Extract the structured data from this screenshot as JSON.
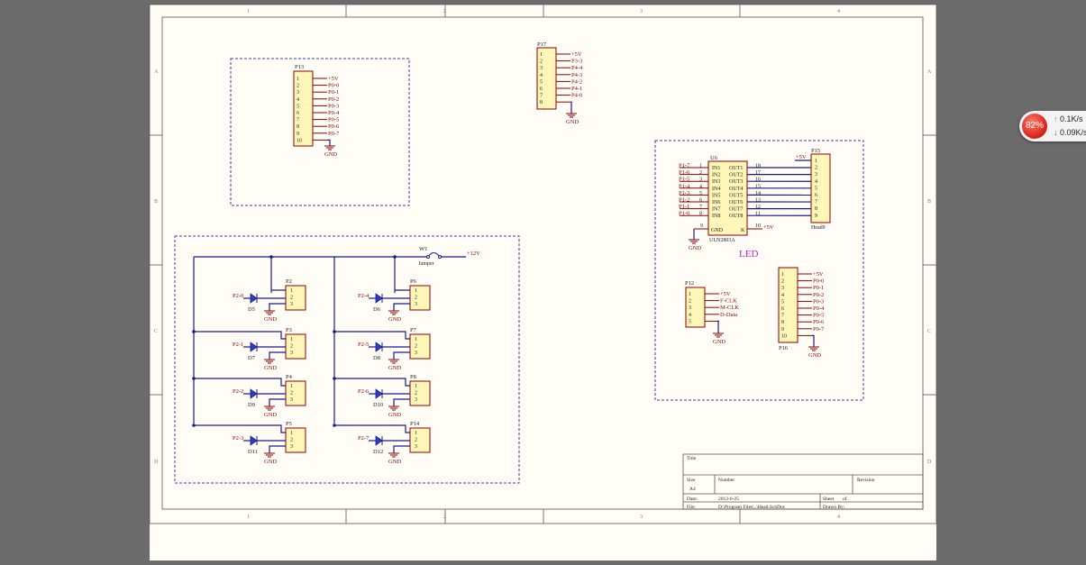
{
  "zones": {
    "columns": [
      "1",
      "2",
      "3",
      "4"
    ],
    "rows": [
      "A",
      "B",
      "C",
      "D"
    ]
  },
  "power": {
    "v5": "+5V",
    "v12": "+12V",
    "gnd": "GND"
  },
  "p13": {
    "ref": "P13",
    "pins": [
      "1",
      "2",
      "3",
      "4",
      "5",
      "6",
      "7",
      "8",
      "9",
      "10"
    ],
    "nets": [
      "+5V",
      "P0-0",
      "P0-1",
      "P0-2",
      "P0-3",
      "P0-4",
      "P0-5",
      "P0-6",
      "P0-7"
    ]
  },
  "p17": {
    "ref": "P17",
    "pins": [
      "1",
      "2",
      "3",
      "4",
      "5",
      "6",
      "7",
      "8"
    ],
    "nets": [
      "+5V",
      "P3-3",
      "P4-4",
      "P4-3",
      "P4-2",
      "P4-1",
      "P4-0"
    ]
  },
  "u6": {
    "ref": "U6",
    "part": "ULN2803A",
    "left_pins": [
      "1",
      "2",
      "3",
      "4",
      "5",
      "6",
      "7",
      "8"
    ],
    "in_labels": [
      "IN1",
      "IN2",
      "IN3",
      "IN4",
      "IN5",
      "IN6",
      "IN7",
      "IN8"
    ],
    "out_labels": [
      "OUT1",
      "OUT2",
      "OUT3",
      "OUT4",
      "OUT5",
      "OUT6",
      "OUT7",
      "OUT8"
    ],
    "right_pins": [
      "18",
      "17",
      "16",
      "15",
      "14",
      "13",
      "12",
      "11"
    ],
    "in_nets": [
      "P1-7",
      "P1-6",
      "P1-5",
      "P1-4",
      "P1-3",
      "P1-2",
      "P1-1",
      "P1-0"
    ],
    "gnd_label": "GND",
    "gnd_pin": "9",
    "k_label": "K",
    "k_pin": "10"
  },
  "p15": {
    "ref": "P15",
    "part": "Head9",
    "pins": [
      "1",
      "2",
      "3",
      "4",
      "5",
      "6",
      "7",
      "8",
      "9"
    ]
  },
  "led_label": "LED",
  "p12": {
    "ref": "P12",
    "pins": [
      "1",
      "2",
      "3",
      "4",
      "5"
    ],
    "nets": [
      "+5V",
      "F-CLK",
      "M-CLK",
      "D-Data"
    ]
  },
  "p16": {
    "ref": "P16",
    "pins": [
      "1",
      "2",
      "3",
      "4",
      "5",
      "6",
      "7",
      "8",
      "9",
      "10"
    ],
    "nets": [
      "+5V",
      "P0-0",
      "P0-1",
      "P0-2",
      "P0-3",
      "P0-4",
      "P0-5",
      "P0-6",
      "P0-7"
    ]
  },
  "w1": {
    "ref": "W1",
    "part": "Jumper"
  },
  "left_group": [
    {
      "net": "P2-0",
      "diode": "D5",
      "conn": "P2"
    },
    {
      "net": "P2-1",
      "diode": "D7",
      "conn": "P3"
    },
    {
      "net": "P2-2",
      "diode": "D9",
      "conn": "P4"
    },
    {
      "net": "P2-3",
      "diode": "D11",
      "conn": "P5"
    }
  ],
  "right_group": [
    {
      "net": "P2-4",
      "diode": "D6",
      "conn": "P6"
    },
    {
      "net": "P2-5",
      "diode": "D8",
      "conn": "P7"
    },
    {
      "net": "P2-6",
      "diode": "D10",
      "conn": "P8"
    },
    {
      "net": "P2-7",
      "diode": "D12",
      "conn": "P14"
    }
  ],
  "three_pins": [
    "1",
    "2",
    "3"
  ],
  "title_block": {
    "title_label": "Title",
    "size_label": "Size",
    "size_value": "A4",
    "number_label": "Number",
    "revision_label": "Revision",
    "date_label": "Date:",
    "date_value": "2012-6-25",
    "sheet_label": "Sheet",
    "of_label": "of",
    "file_label": "File:",
    "file_value": "D:\\Program Files\\..\\Head.SchDoc",
    "drawn_label": "Drawn By:"
  },
  "widget": {
    "cpu": "82%",
    "up_arrow": "↑",
    "up": "0.1K/s",
    "down_arrow": "↓",
    "down": "0.09K/s"
  }
}
